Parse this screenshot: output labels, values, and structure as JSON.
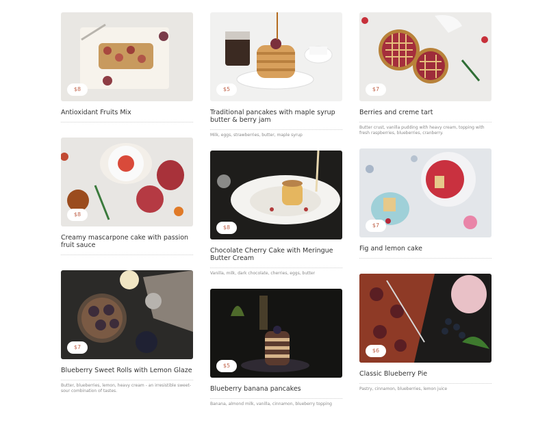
{
  "cards": [
    {
      "title": "Antioxidant Fruits Mix",
      "price": "$8",
      "description": ""
    },
    {
      "title": "Creamy mascarpone cake with passion fruit sauce",
      "price": "$8",
      "description": ""
    },
    {
      "title": "Blueberry Sweet Rolls with Lemon Glaze",
      "price": "$7",
      "description": "Butter, blueberries, lemon, heavy cream - an irresistible sweet-sour combination of tastes."
    },
    {
      "title": "Traditional pancakes with maple syrup butter & berry jam",
      "price": "$5",
      "description": "Milk, eggs, strawberries, butter, maple syrup"
    },
    {
      "title": "Chocolate Cherry Cake with Meringue Butter Cream",
      "price": "$8",
      "description": "Vanilla, milk, dark chocolate, cherries, eggs, butter"
    },
    {
      "title": "Blueberry banana pancakes",
      "price": "$5",
      "description": "Banana, almond milk, vanilla, cinnamon, blueberry topping"
    },
    {
      "title": "Berries and creme tart",
      "price": "$7",
      "description": "Butter crust, vanilla pudding with heavy cream, topping with fresh raspberries, blueberries, cranberry."
    },
    {
      "title": "Fig and lemon cake",
      "price": "$7",
      "description": ""
    },
    {
      "title": "Classic Blueberry Pie",
      "price": "$6",
      "description": "Pastry, cinnamon, blueberries, lemon juice"
    }
  ],
  "colors": {
    "price_text": "#c0634a",
    "title_text": "#333333",
    "desc_text": "#888888"
  }
}
